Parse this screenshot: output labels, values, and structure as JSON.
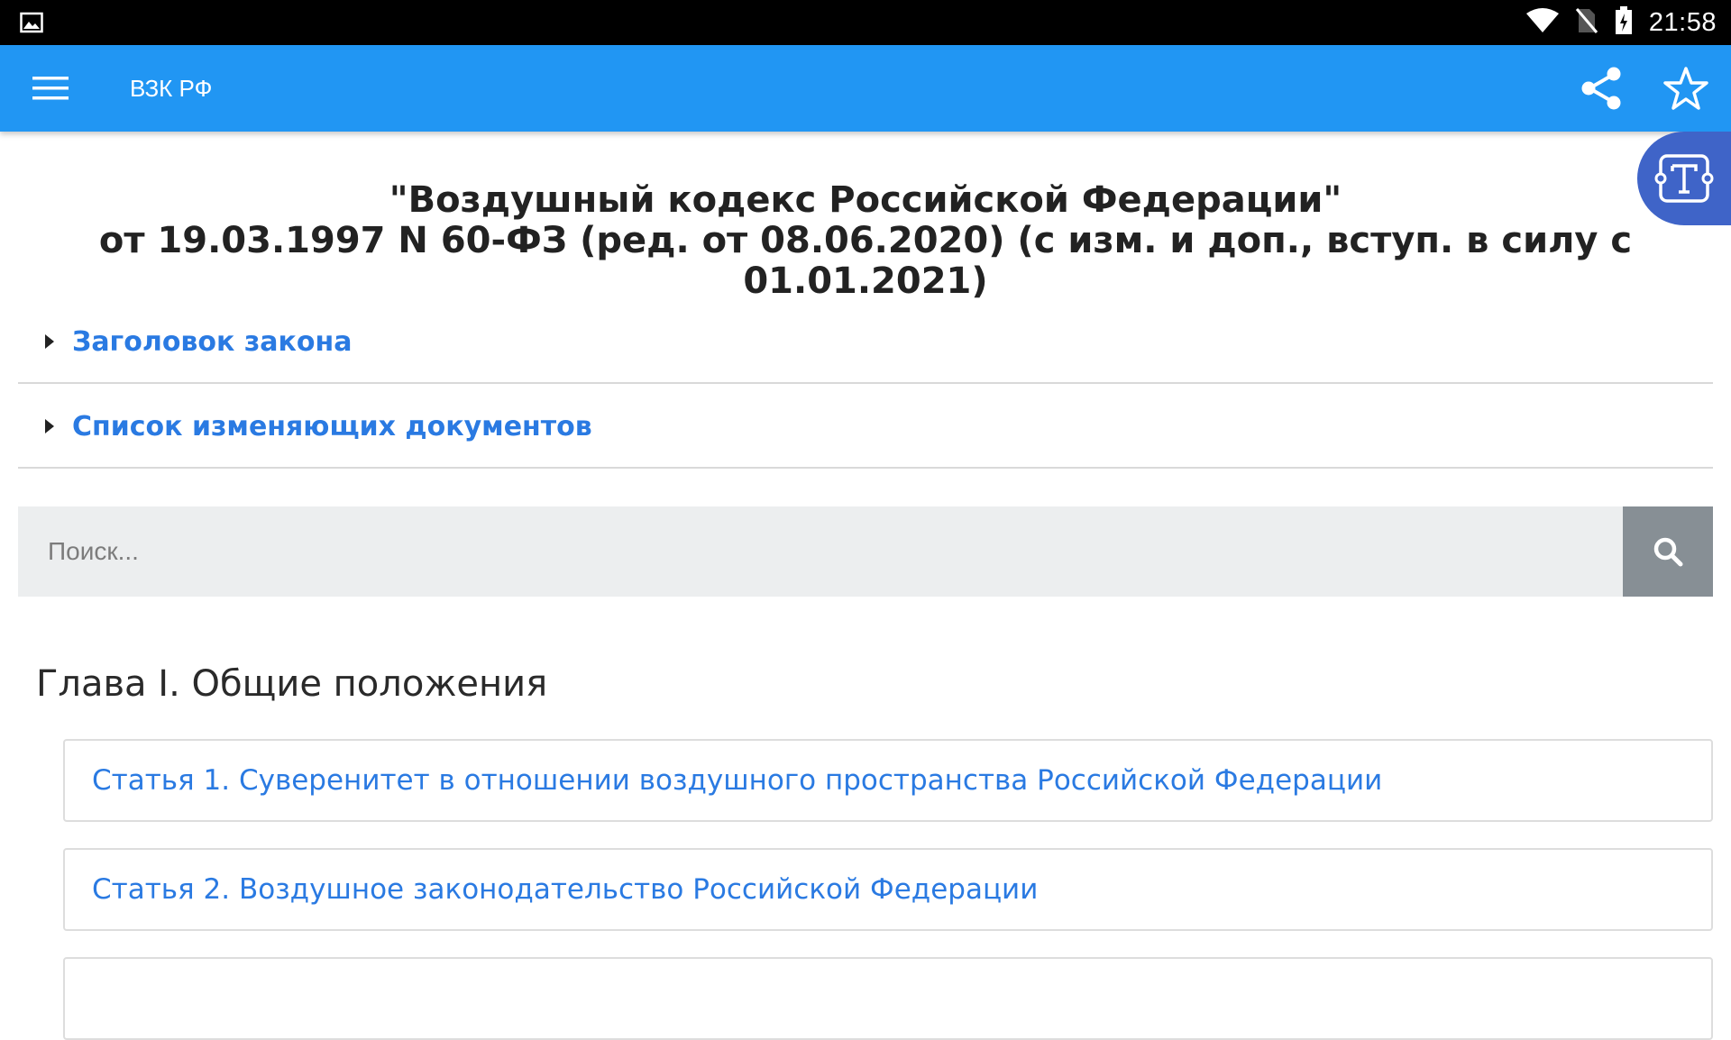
{
  "status_bar": {
    "time": "21:58",
    "icons": [
      "image-notification-icon",
      "wifi-icon",
      "no-sim-icon",
      "battery-charging-icon"
    ]
  },
  "app_bar": {
    "title": "ВЗК РФ",
    "background": "#2196f3",
    "actions": [
      "menu-icon",
      "share-icon",
      "star-icon"
    ]
  },
  "fab": {
    "icon": "text-format-icon",
    "color": "#3f64c8"
  },
  "document": {
    "title_line1": "\"Воздушный кодекс Российской Федерации\"",
    "title_line2": "от 19.03.1997 N 60-ФЗ (ред. от 08.06.2020) (с изм. и доп., вступ. в силу с 01.01.2021)"
  },
  "sections": [
    {
      "label": "Заголовок закона"
    },
    {
      "label": "Список изменяющих документов"
    }
  ],
  "search": {
    "placeholder": "Поиск...",
    "value": ""
  },
  "chapter": {
    "title": "Глава I. Общие положения",
    "articles": [
      {
        "label": "Статья 1. Суверенитет в отношении воздушного пространства Российской Федерации"
      },
      {
        "label": "Статья 2. Воздушное законодательство Российской Федерации"
      },
      {
        "label": ""
      }
    ]
  },
  "colors": {
    "link": "#2a7ae2",
    "accent": "#2196f3",
    "search_button": "#878f95"
  }
}
